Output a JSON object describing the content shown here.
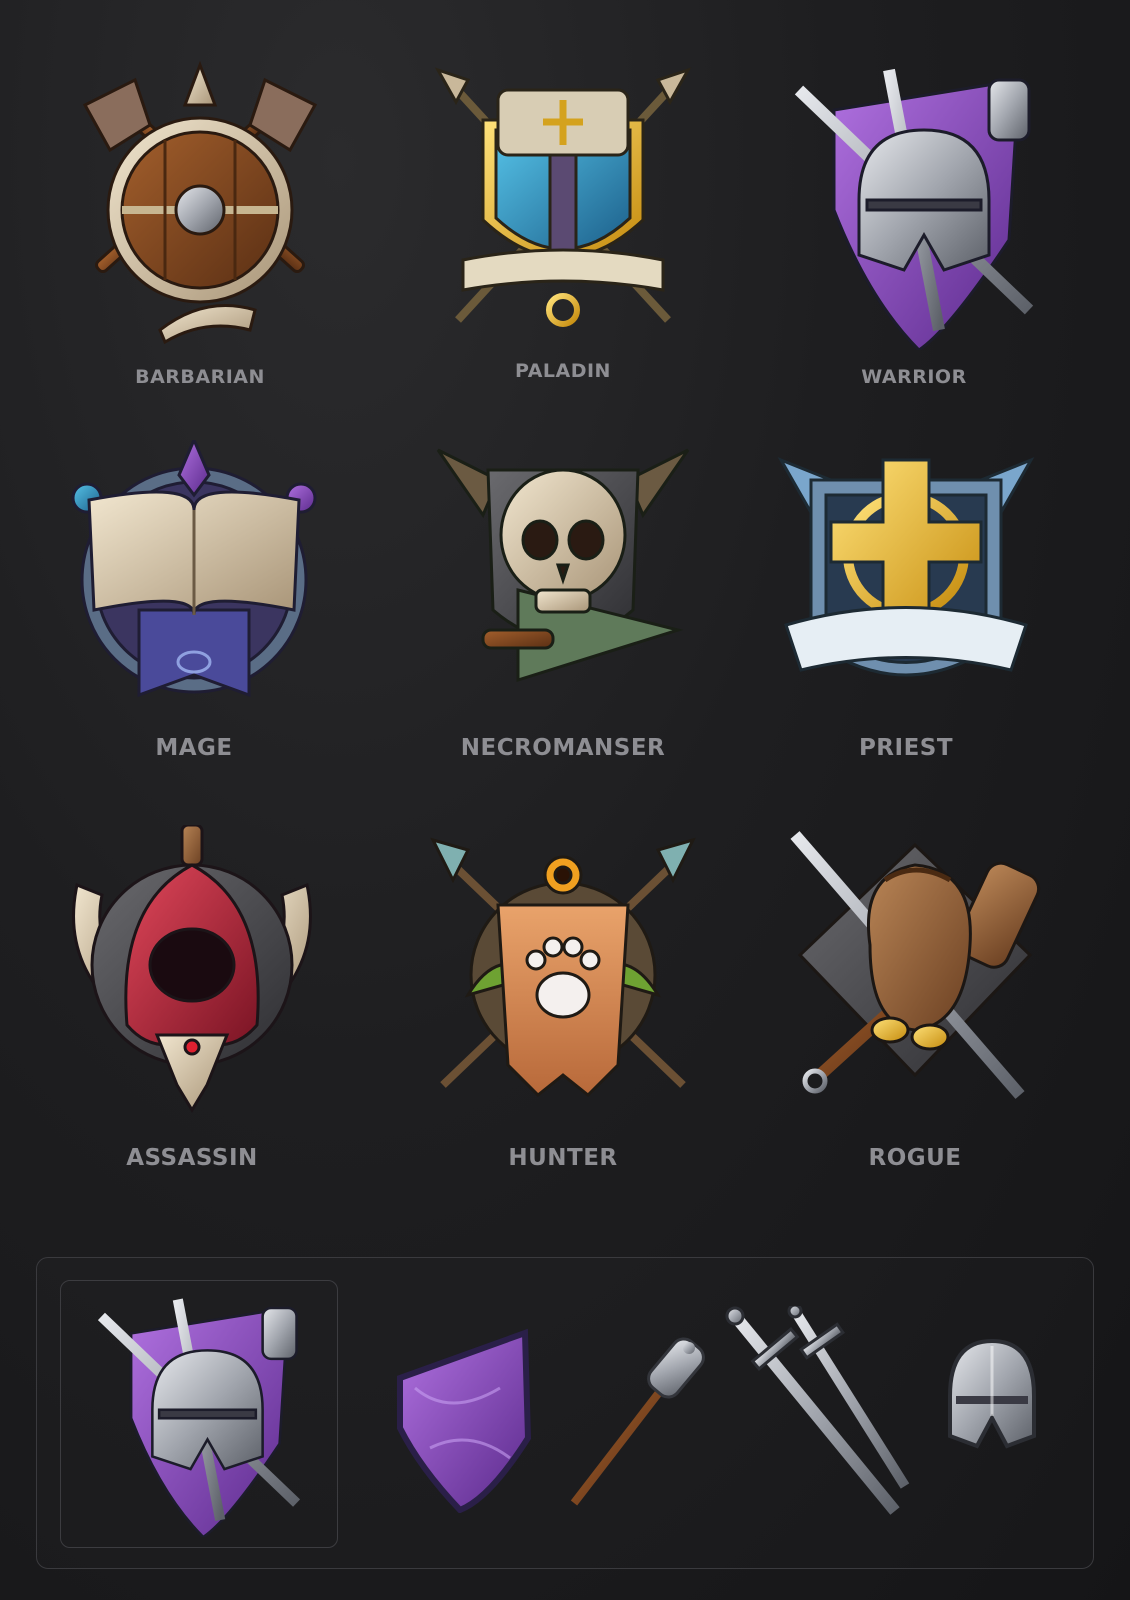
{
  "classes": [
    {
      "name": "BARBARIAN"
    },
    {
      "name": "PALADIN"
    },
    {
      "name": "WARRIOR"
    },
    {
      "name": "MAGE"
    },
    {
      "name": "NECROMANSER"
    },
    {
      "name": "PRIEST"
    },
    {
      "name": "ASSASSIN"
    },
    {
      "name": "HUNTER"
    },
    {
      "name": "ROGUE"
    }
  ],
  "breakdown": {
    "parts": [
      "warrior-emblem-composite",
      "purple-shield",
      "spiked-mace",
      "crossed-swords",
      "knight-helmet"
    ]
  },
  "colors": {
    "background": "#1e1e20",
    "label": "#8e8e93",
    "warrior_purple": "#7a3fb0",
    "paladin_blue": "#2e8fb8",
    "priest_gold": "#e3b41c",
    "assassin_red": "#b8283a",
    "hunter_orange": "#d9884a",
    "rogue_leather": "#8a5a36"
  }
}
